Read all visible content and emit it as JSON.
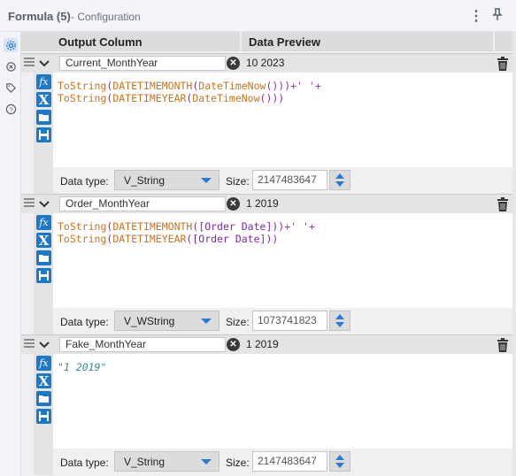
{
  "title": {
    "main": "Formula (5)",
    "sub": "- Configuration"
  },
  "header": {
    "output_column": "Output Column",
    "data_preview": "Data Preview"
  },
  "sidebar": {
    "items": [
      "gear-icon",
      "tool-settings-icon",
      "tag-icon",
      "help-icon"
    ]
  },
  "formulas": [
    {
      "name": "Current_MonthYear",
      "preview": "10 2023",
      "line1": {
        "fn1": "ToString",
        "p1": "(",
        "fn2": "DATETIMEMONTH",
        "p2": "(",
        "arg": "DateTimeNow",
        "p3": "()))",
        "str": "+' '+"
      },
      "line2": {
        "fn1": "ToString",
        "p1": "(",
        "fn2": "DATETIMEYEAR",
        "p2": "(",
        "arg": "DateTimeNow",
        "p3": "()))"
      },
      "data_type_label": "Data type:",
      "data_type": "V_String",
      "size_label": "Size:",
      "size": "2147483647"
    },
    {
      "name": "Order_MonthYear",
      "preview": "1 2019",
      "line1": {
        "fn1": "ToString",
        "p1": "(",
        "fn2": "DATETIMEMONTH",
        "p2": "(",
        "arg": "[Order Date]",
        "p3": "))",
        "str": "+' '+"
      },
      "line2": {
        "fn1": "ToString",
        "p1": "(",
        "fn2": "DATETIMEYEAR",
        "p2": "(",
        "arg": "[Order Date]",
        "p3": "))"
      },
      "data_type_label": "Data type:",
      "data_type": "V_WString",
      "size_label": "Size:",
      "size": "1073741823"
    },
    {
      "name": "Fake_MonthYear",
      "preview": "1 2019",
      "literal": "\"1 2019\"",
      "data_type_label": "Data type:",
      "data_type": "V_String",
      "size_label": "Size:",
      "size": "2147483647"
    }
  ],
  "colors": {
    "accent": "#1e78c8",
    "function": "#c8741f",
    "paren": "#8c2aa8",
    "literal": "#3a8f8f"
  }
}
